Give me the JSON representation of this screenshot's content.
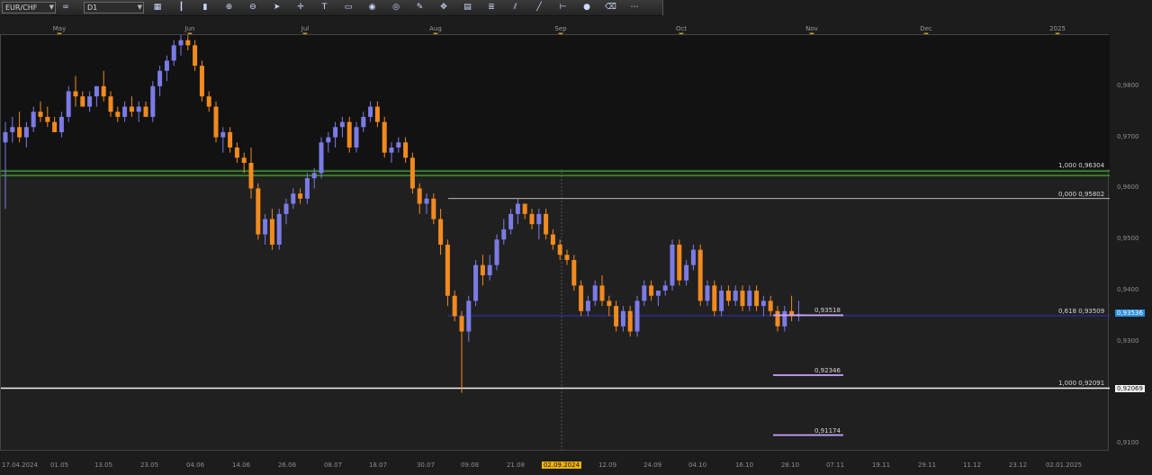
{
  "toolbar": {
    "symbol": "EUR/CHF",
    "timeframe": "D1",
    "tools": [
      "chart-type-icon",
      "bar-chart-icon",
      "candle-chart-icon",
      "zoom-in-icon",
      "zoom-out-icon",
      "pointer-icon",
      "crosshair-icon",
      "text-tool-icon",
      "note-icon",
      "comment-icon",
      "globe-icon",
      "pencil-icon",
      "move-icon",
      "template-icon",
      "fibonacci-icon",
      "channel-icon",
      "trend-icon",
      "measure-icon",
      "bullet-icon",
      "eraser-icon",
      "more-icon"
    ]
  },
  "months": [
    "May",
    "Jun",
    "Jul",
    "Aug",
    "Sep",
    "Oct",
    "Nov",
    "Dec",
    "2025"
  ],
  "dates": [
    "17.04.2024",
    "01.05",
    "13.05",
    "23.05",
    "04.06",
    "14.06",
    "26.06",
    "08.07",
    "18.07",
    "30.07",
    "09.08",
    "21.08",
    "02.09.2024",
    "12.09",
    "24.09",
    "04.10",
    "16.10",
    "28.10",
    "07.11",
    "19.11",
    "29.11",
    "11.12",
    "23.12",
    "02.01.2025"
  ],
  "highlighted_date": "02.09.2024",
  "price_ticks": [
    "0,9800",
    "0,9700",
    "0,9600",
    "0,9500",
    "0,9400",
    "0,9300",
    "0,9100"
  ],
  "current_price": "0,93536",
  "low_price_badge": "0,92069",
  "fib_labels": {
    "upper_100": "1,000 0,96304",
    "upper_0": "0,000 0,95802",
    "fib_618": "0,618 0,93509",
    "lower_100": "1,000 0,92091"
  },
  "projection_labels": [
    "0,93518",
    "0,92346",
    "0,91174"
  ],
  "colors": {
    "bull": "#7b7be6",
    "bear": "#f28a1e",
    "support": "#3fae2a",
    "fib_blue": "#2a35b8",
    "projection": "#c9a3ff"
  },
  "chart_data": {
    "type": "candlestick",
    "symbol": "EUR/CHF",
    "timeframe": "D1",
    "ylim": [
      0.9085,
      0.99
    ],
    "levels": [
      0.96304,
      0.95802,
      0.93509,
      0.92091,
      0.93518,
      0.92346,
      0.91174
    ],
    "candles": [
      [
        0.969,
        0.973,
        0.956,
        0.971
      ],
      [
        0.971,
        0.974,
        0.969,
        0.972
      ],
      [
        0.972,
        0.975,
        0.969,
        0.97
      ],
      [
        0.97,
        0.973,
        0.968,
        0.972
      ],
      [
        0.972,
        0.976,
        0.971,
        0.975
      ],
      [
        0.975,
        0.977,
        0.973,
        0.974
      ],
      [
        0.974,
        0.976,
        0.972,
        0.973
      ],
      [
        0.973,
        0.974,
        0.971,
        0.971
      ],
      [
        0.971,
        0.975,
        0.97,
        0.974
      ],
      [
        0.974,
        0.98,
        0.973,
        0.979
      ],
      [
        0.979,
        0.982,
        0.976,
        0.978
      ],
      [
        0.978,
        0.979,
        0.976,
        0.976
      ],
      [
        0.976,
        0.979,
        0.975,
        0.978
      ],
      [
        0.978,
        0.98,
        0.976,
        0.98
      ],
      [
        0.98,
        0.983,
        0.977,
        0.978
      ],
      [
        0.978,
        0.979,
        0.974,
        0.975
      ],
      [
        0.975,
        0.976,
        0.973,
        0.974
      ],
      [
        0.974,
        0.977,
        0.973,
        0.976
      ],
      [
        0.976,
        0.978,
        0.974,
        0.975
      ],
      [
        0.975,
        0.977,
        0.973,
        0.976
      ],
      [
        0.976,
        0.977,
        0.974,
        0.974
      ],
      [
        0.974,
        0.981,
        0.973,
        0.98
      ],
      [
        0.98,
        0.984,
        0.978,
        0.983
      ],
      [
        0.983,
        0.986,
        0.981,
        0.985
      ],
      [
        0.985,
        0.989,
        0.984,
        0.988
      ],
      [
        0.988,
        0.99,
        0.986,
        0.989
      ],
      [
        0.989,
        0.99,
        0.987,
        0.988
      ],
      [
        0.988,
        0.989,
        0.983,
        0.984
      ],
      [
        0.984,
        0.985,
        0.977,
        0.978
      ],
      [
        0.978,
        0.979,
        0.975,
        0.976
      ],
      [
        0.976,
        0.977,
        0.969,
        0.97
      ],
      [
        0.97,
        0.972,
        0.967,
        0.971
      ],
      [
        0.971,
        0.972,
        0.967,
        0.968
      ],
      [
        0.968,
        0.969,
        0.965,
        0.966
      ],
      [
        0.966,
        0.967,
        0.963,
        0.965
      ],
      [
        0.965,
        0.968,
        0.958,
        0.96
      ],
      [
        0.96,
        0.961,
        0.95,
        0.951
      ],
      [
        0.951,
        0.955,
        0.949,
        0.954
      ],
      [
        0.954,
        0.956,
        0.948,
        0.949
      ],
      [
        0.949,
        0.956,
        0.948,
        0.955
      ],
      [
        0.955,
        0.958,
        0.953,
        0.957
      ],
      [
        0.957,
        0.96,
        0.956,
        0.959
      ],
      [
        0.959,
        0.96,
        0.957,
        0.958
      ],
      [
        0.958,
        0.963,
        0.957,
        0.962
      ],
      [
        0.962,
        0.964,
        0.96,
        0.963
      ],
      [
        0.963,
        0.97,
        0.962,
        0.969
      ],
      [
        0.969,
        0.971,
        0.967,
        0.97
      ],
      [
        0.97,
        0.973,
        0.968,
        0.972
      ],
      [
        0.972,
        0.974,
        0.97,
        0.973
      ],
      [
        0.973,
        0.974,
        0.967,
        0.968
      ],
      [
        0.968,
        0.973,
        0.967,
        0.972
      ],
      [
        0.972,
        0.975,
        0.971,
        0.974
      ],
      [
        0.974,
        0.977,
        0.973,
        0.976
      ],
      [
        0.976,
        0.977,
        0.972,
        0.973
      ],
      [
        0.973,
        0.974,
        0.966,
        0.967
      ],
      [
        0.967,
        0.969,
        0.965,
        0.968
      ],
      [
        0.968,
        0.97,
        0.967,
        0.969
      ],
      [
        0.969,
        0.97,
        0.965,
        0.966
      ],
      [
        0.966,
        0.967,
        0.959,
        0.96
      ],
      [
        0.96,
        0.961,
        0.955,
        0.957
      ],
      [
        0.957,
        0.959,
        0.955,
        0.958
      ],
      [
        0.958,
        0.959,
        0.953,
        0.954
      ],
      [
        0.954,
        0.956,
        0.947,
        0.949
      ],
      [
        0.949,
        0.95,
        0.937,
        0.939
      ],
      [
        0.939,
        0.94,
        0.934,
        0.935
      ],
      [
        0.935,
        0.936,
        0.92,
        0.932
      ],
      [
        0.932,
        0.939,
        0.93,
        0.938
      ],
      [
        0.938,
        0.946,
        0.937,
        0.945
      ],
      [
        0.945,
        0.947,
        0.941,
        0.943
      ],
      [
        0.943,
        0.947,
        0.942,
        0.945
      ],
      [
        0.945,
        0.951,
        0.944,
        0.95
      ],
      [
        0.95,
        0.954,
        0.949,
        0.952
      ],
      [
        0.952,
        0.956,
        0.951,
        0.955
      ],
      [
        0.955,
        0.958,
        0.953,
        0.957
      ],
      [
        0.957,
        0.957,
        0.954,
        0.955
      ],
      [
        0.955,
        0.956,
        0.952,
        0.953
      ],
      [
        0.953,
        0.956,
        0.95,
        0.955
      ],
      [
        0.955,
        0.956,
        0.95,
        0.951
      ],
      [
        0.951,
        0.952,
        0.948,
        0.949
      ],
      [
        0.949,
        0.95,
        0.946,
        0.947
      ],
      [
        0.947,
        0.948,
        0.945,
        0.946
      ],
      [
        0.946,
        0.947,
        0.94,
        0.941
      ],
      [
        0.941,
        0.942,
        0.935,
        0.936
      ],
      [
        0.936,
        0.939,
        0.935,
        0.938
      ],
      [
        0.938,
        0.942,
        0.937,
        0.941
      ],
      [
        0.941,
        0.943,
        0.937,
        0.938
      ],
      [
        0.938,
        0.939,
        0.935,
        0.937
      ],
      [
        0.937,
        0.938,
        0.932,
        0.933
      ],
      [
        0.933,
        0.937,
        0.932,
        0.936
      ],
      [
        0.936,
        0.937,
        0.931,
        0.932
      ],
      [
        0.932,
        0.939,
        0.931,
        0.938
      ],
      [
        0.938,
        0.942,
        0.937,
        0.941
      ],
      [
        0.941,
        0.942,
        0.938,
        0.939
      ],
      [
        0.939,
        0.94,
        0.937,
        0.94
      ],
      [
        0.94,
        0.942,
        0.939,
        0.941
      ],
      [
        0.941,
        0.95,
        0.94,
        0.949
      ],
      [
        0.949,
        0.95,
        0.941,
        0.942
      ],
      [
        0.942,
        0.946,
        0.941,
        0.945
      ],
      [
        0.945,
        0.949,
        0.944,
        0.948
      ],
      [
        0.948,
        0.949,
        0.937,
        0.938
      ],
      [
        0.938,
        0.942,
        0.937,
        0.941
      ],
      [
        0.941,
        0.942,
        0.935,
        0.936
      ],
      [
        0.936,
        0.941,
        0.935,
        0.94
      ],
      [
        0.94,
        0.941,
        0.937,
        0.938
      ],
      [
        0.938,
        0.941,
        0.937,
        0.94
      ],
      [
        0.94,
        0.941,
        0.936,
        0.937
      ],
      [
        0.937,
        0.941,
        0.936,
        0.94
      ],
      [
        0.94,
        0.941,
        0.936,
        0.937
      ],
      [
        0.937,
        0.939,
        0.935,
        0.938
      ],
      [
        0.938,
        0.939,
        0.935,
        0.936
      ],
      [
        0.936,
        0.937,
        0.932,
        0.933
      ],
      [
        0.933,
        0.937,
        0.932,
        0.936
      ],
      [
        0.936,
        0.939,
        0.934,
        0.935
      ],
      [
        0.935,
        0.938,
        0.934,
        0.9354
      ]
    ]
  }
}
